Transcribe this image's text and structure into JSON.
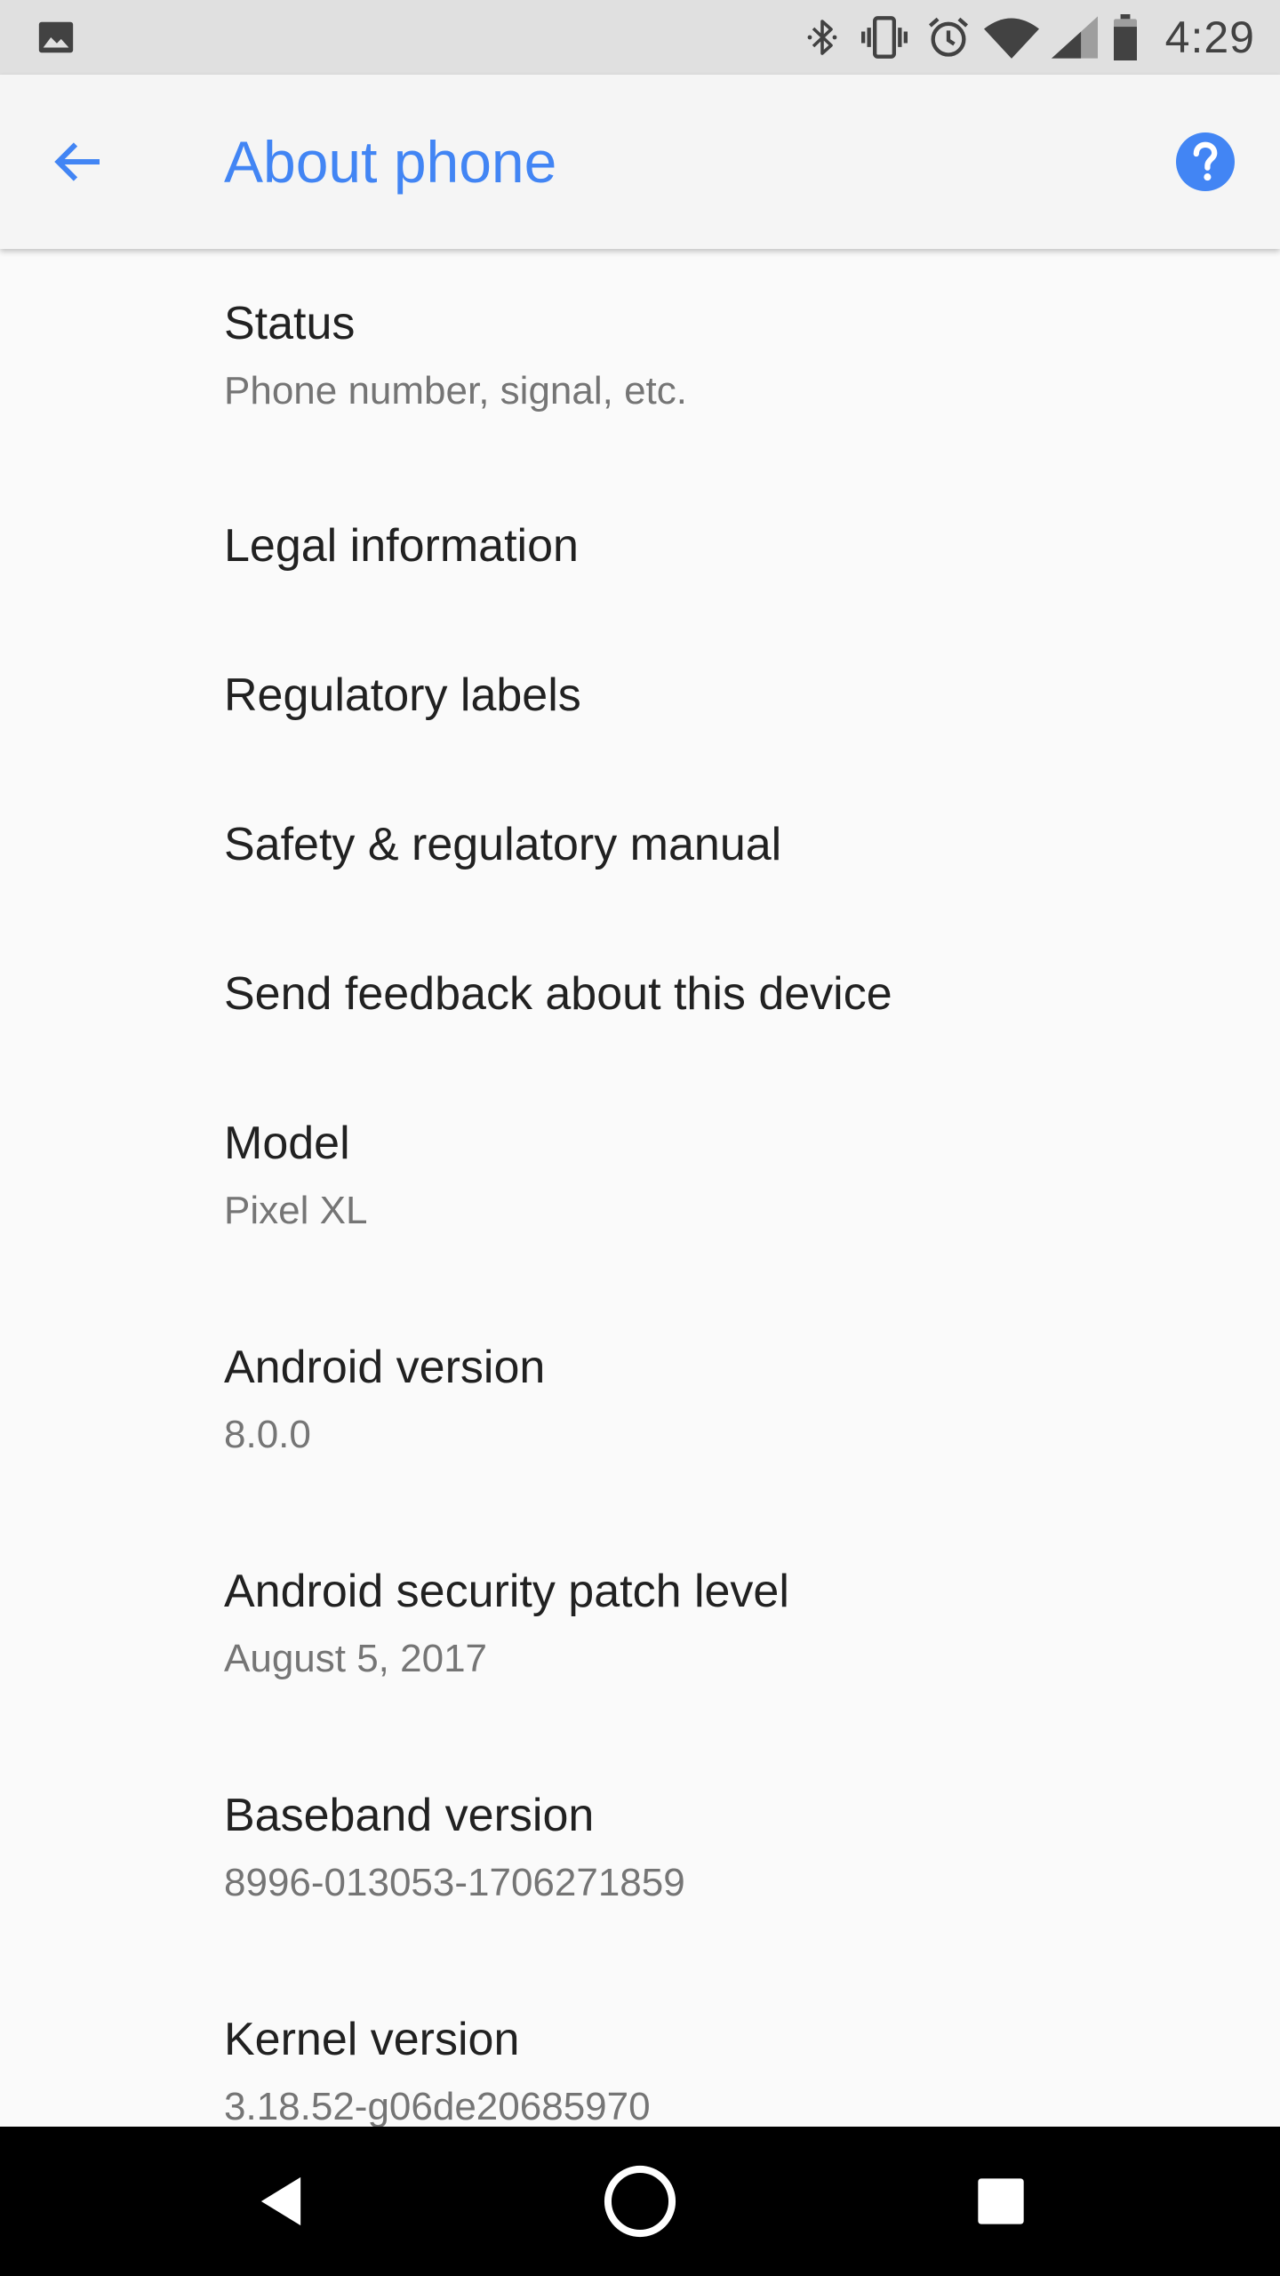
{
  "status_bar": {
    "time": "4:29",
    "icons": [
      "image-notification-icon",
      "bluetooth-icon",
      "vibrate-icon",
      "alarm-icon",
      "wifi-icon",
      "cell-signal-icon",
      "battery-icon"
    ]
  },
  "app_bar": {
    "title": "About phone",
    "back_icon": "arrow-back-icon",
    "help_icon": "help-icon"
  },
  "colors": {
    "accent": "#4285f4",
    "title_text": "#212121",
    "summary_text": "#757575",
    "background": "#fafafa",
    "status_bar": "#e0e0e0",
    "nav_bar": "#000000"
  },
  "items": [
    {
      "title": "Status",
      "summary": "Phone number, signal, etc."
    },
    {
      "title": "Legal information",
      "summary": ""
    },
    {
      "title": "Regulatory labels",
      "summary": ""
    },
    {
      "title": "Safety & regulatory manual",
      "summary": ""
    },
    {
      "title": "Send feedback about this device",
      "summary": ""
    },
    {
      "title": "Model",
      "summary": "Pixel XL"
    },
    {
      "title": "Android version",
      "summary": "8.0.0"
    },
    {
      "title": "Android security patch level",
      "summary": "August 5, 2017"
    },
    {
      "title": "Baseband version",
      "summary": "8996-013053-1706271859"
    },
    {
      "title": "Kernel version",
      "summary": "3.18.52-g06de20685970"
    }
  ],
  "nav_bar": {
    "buttons": [
      "back-triangle-icon",
      "home-circle-icon",
      "recents-square-icon"
    ]
  }
}
